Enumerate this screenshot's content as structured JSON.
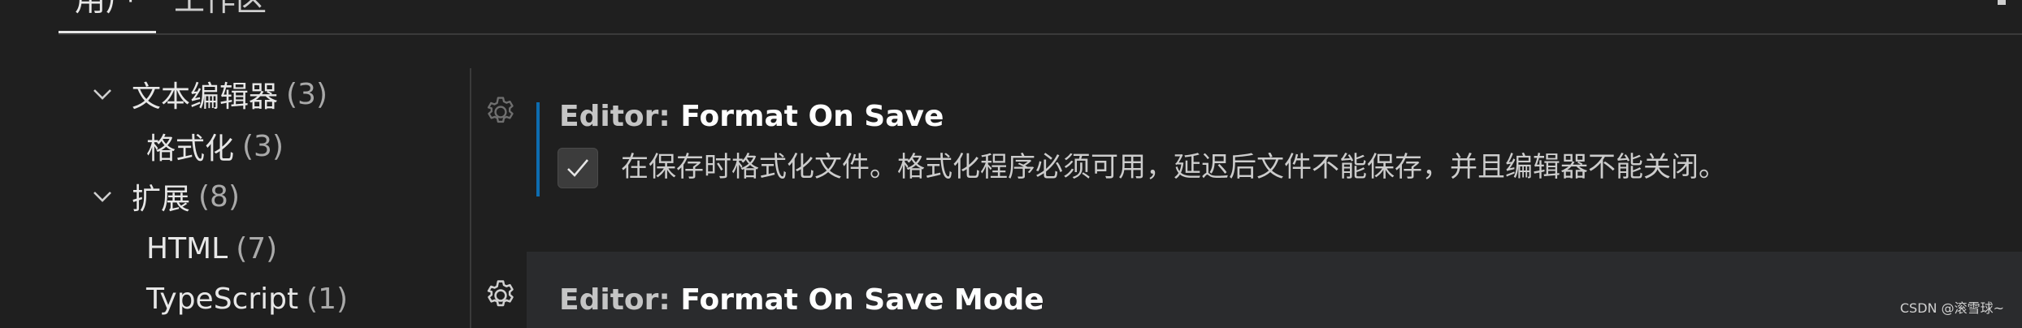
{
  "tabs": {
    "user": "用户",
    "workspace": "工作区"
  },
  "toc": {
    "items": [
      {
        "label": "文本编辑器",
        "count": "(3)",
        "expanded": true,
        "level": 0
      },
      {
        "label": "格式化",
        "count": "(3)",
        "level": 1
      },
      {
        "label": "扩展",
        "count": "(8)",
        "expanded": true,
        "level": 0
      },
      {
        "label": "HTML",
        "count": "(7)",
        "level": 1
      },
      {
        "label": "TypeScript",
        "count": "(1)",
        "level": 1
      }
    ]
  },
  "settings": [
    {
      "category": "Editor: ",
      "name": "Format On Save",
      "checked": true,
      "description": "在保存时格式化文件。格式化程序必须可用，延迟后文件不能保存，并且编辑器不能关闭。"
    },
    {
      "category": "Editor: ",
      "name": "Format On Save Mode"
    }
  ],
  "watermark": "CSDN @滚雪球~",
  "colors": {
    "background": "#1f1f1f",
    "focus_accent": "#0a7aca",
    "hovered_row": "#2a2b2d",
    "text_primary": "#e7e7e7",
    "text_muted": "#a9a9a9"
  }
}
